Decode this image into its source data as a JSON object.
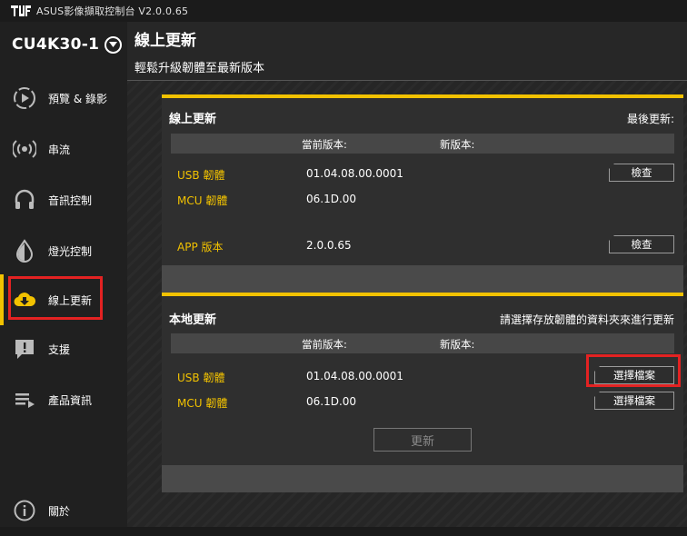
{
  "app": {
    "title": "ASUS影像擷取控制台 V2.0.0.65"
  },
  "device": {
    "name": "CU4K30-1"
  },
  "sidebar": {
    "items": [
      {
        "label": "預覽 & 錄影",
        "icon": "play-circle-icon"
      },
      {
        "label": "串流",
        "icon": "broadcast-icon"
      },
      {
        "label": "音訊控制",
        "icon": "headphones-icon"
      },
      {
        "label": "燈光控制",
        "icon": "light-drop-icon"
      },
      {
        "label": "線上更新",
        "icon": "cloud-download-icon",
        "active": true
      },
      {
        "label": "支援",
        "icon": "support-chat-icon"
      },
      {
        "label": "產品資訊",
        "icon": "product-info-icon"
      },
      {
        "label": "關於",
        "icon": "info-icon"
      }
    ]
  },
  "header": {
    "title": "線上更新",
    "subtitle": "輕鬆升級韌體至最新版本"
  },
  "online": {
    "title": "線上更新",
    "last_update_label": "最後更新:",
    "col_current": "當前版本:",
    "col_new": "新版本:",
    "rows": [
      {
        "label": "USB 韌體",
        "current": "01.04.08.00.0001"
      },
      {
        "label": "MCU 韌體",
        "current": "06.1D.00"
      },
      {
        "label": "APP 版本",
        "current": "2.0.0.65"
      }
    ],
    "check_label": "檢查"
  },
  "local": {
    "title": "本地更新",
    "hint": "請選擇存放韌體的資料夾來進行更新",
    "col_current": "當前版本:",
    "col_new": "新版本:",
    "rows": [
      {
        "label": "USB 韌體",
        "current": "01.04.08.00.0001"
      },
      {
        "label": "MCU 韌體",
        "current": "06.1D.00"
      }
    ],
    "select_label": "選擇檔案",
    "update_label": "更新"
  },
  "colors": {
    "accent": "#f2c200",
    "highlight": "#e32222",
    "background": "#2a2a2a"
  }
}
